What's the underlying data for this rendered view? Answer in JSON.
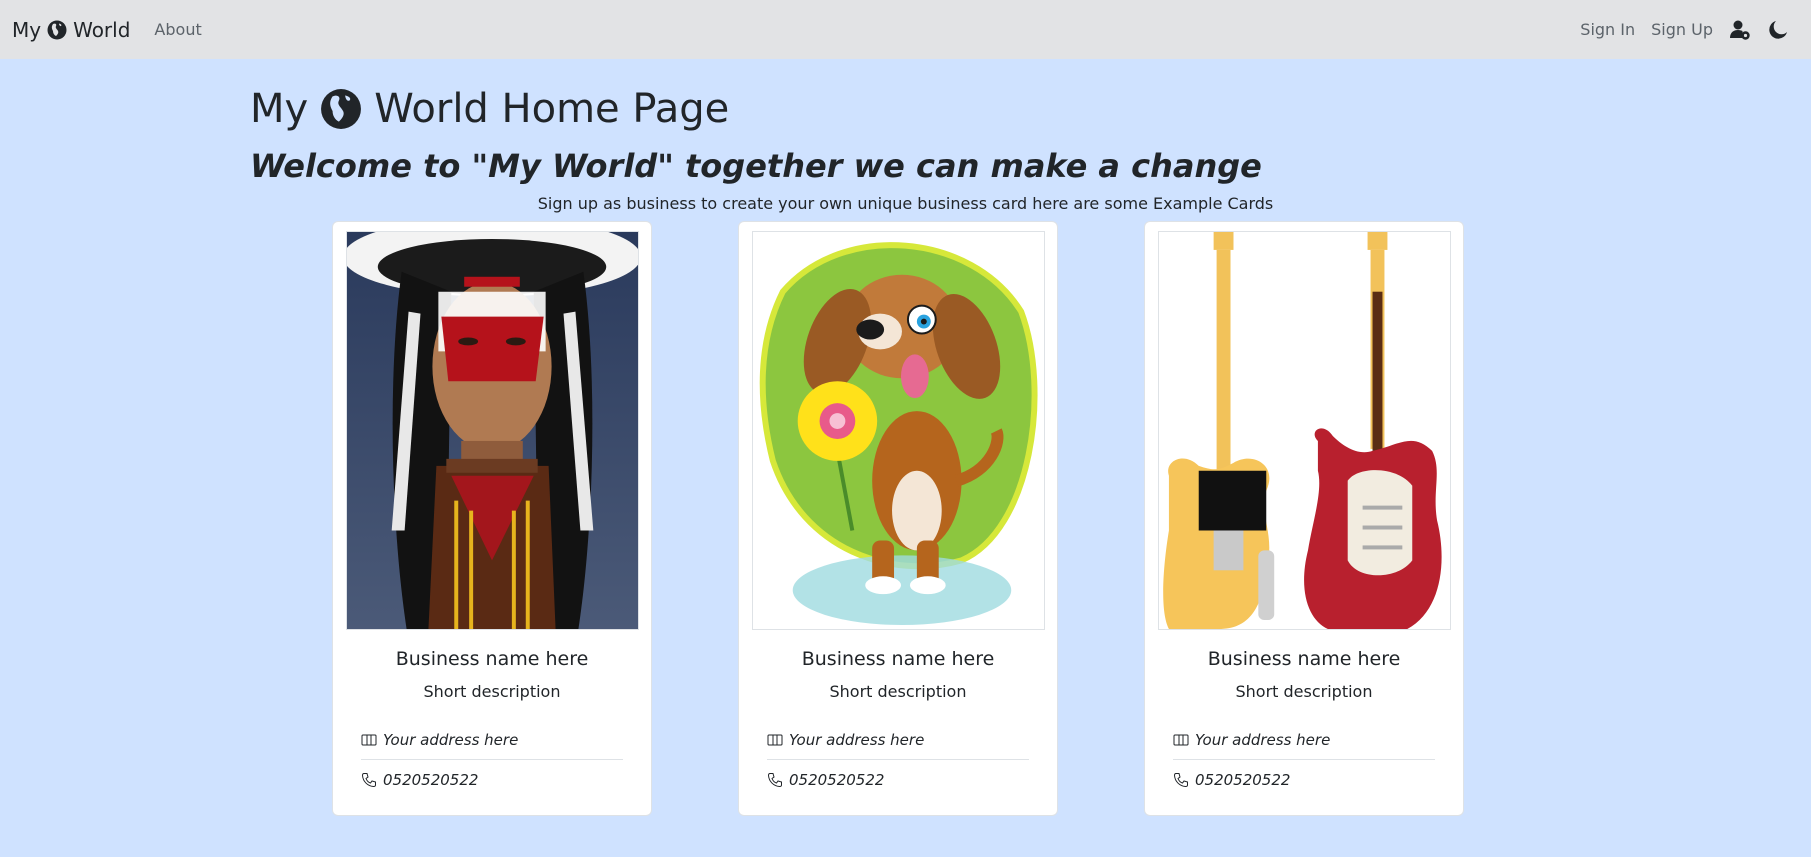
{
  "navbar": {
    "brand_prefix": "My",
    "brand_suffix": "World",
    "about_label": "About",
    "sign_in_label": "Sign In",
    "sign_up_label": "Sign Up",
    "user_icon": "person-gear-icon",
    "theme_icon": "moon-icon"
  },
  "header": {
    "title_prefix": "My",
    "title_suffix": "World Home Page",
    "subtitle": "Welcome to \"My World\" together we can make a change",
    "intro": "Sign up as business to create your own unique business card here are some Example Cards"
  },
  "cards": [
    {
      "image": "native-chief-portrait",
      "title": "Business name here",
      "description": "Short description",
      "address": "Your address here",
      "phone": "0520520522"
    },
    {
      "image": "cartoon-dog-with-flower",
      "title": "Business name here",
      "description": "Short description",
      "address": "Your address here",
      "phone": "0520520522"
    },
    {
      "image": "electric-guitars",
      "title": "Business name here",
      "description": "Short description",
      "address": "Your address here",
      "phone": "0520520522"
    }
  ],
  "colors": {
    "page_bg": "#cfe2ff",
    "navbar_bg": "#e2e3e5",
    "text": "#212529",
    "muted": "#5c636a"
  }
}
